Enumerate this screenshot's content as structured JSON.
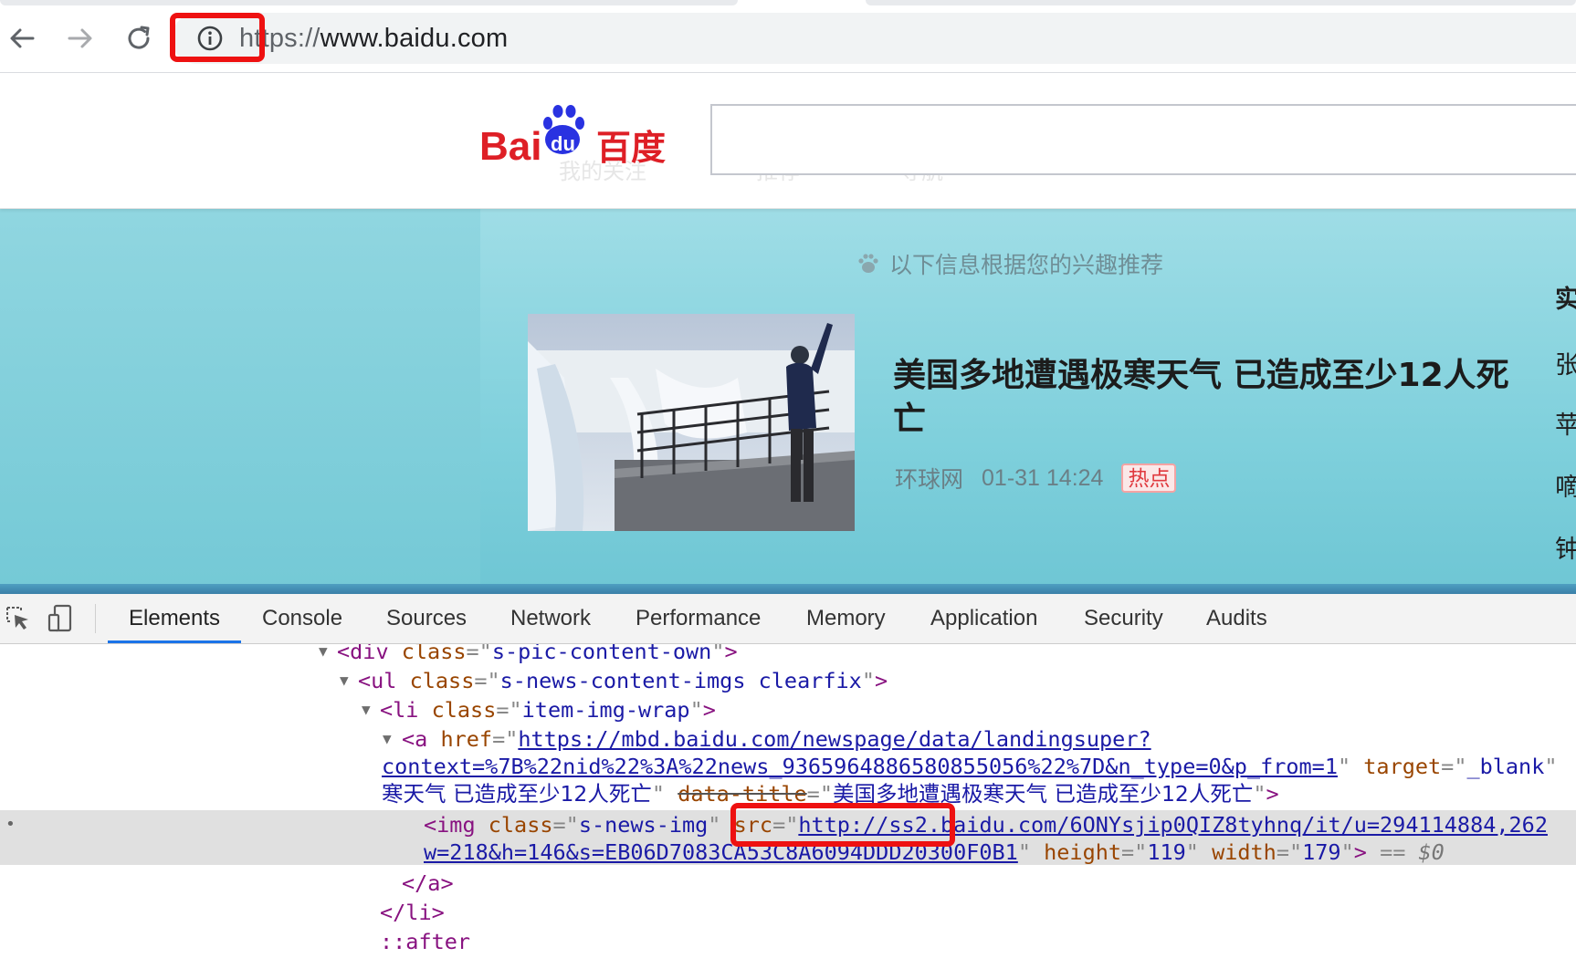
{
  "browser": {
    "url_scheme": "h",
    "url_scheme_rest": "ttps://",
    "url_host": "www.baidu.com"
  },
  "page": {
    "logo_text_bai": "Bai",
    "logo_text_du": "du",
    "logo_text_cn": "百度",
    "ghost_menu": [
      "我的关注",
      "推荐",
      "导航"
    ],
    "recommend_text": "以下信息根据您的兴趣推荐",
    "news": {
      "title": "美国多地遭遇极寒天气 已造成至少12人死亡",
      "source": "环球网",
      "time": "01-31 14:24",
      "badge": "热点"
    },
    "side_chars": [
      "实",
      "张",
      "苹",
      "嘀",
      "钟"
    ]
  },
  "devtools": {
    "tabs": [
      "Elements",
      "Console",
      "Sources",
      "Network",
      "Performance",
      "Memory",
      "Application",
      "Security",
      "Audits"
    ],
    "active_tab": "Elements",
    "lines": {
      "l1_tag": "div",
      "l1_attr": "class",
      "l1_val": "s-pic-content-own",
      "l2_tag": "ul",
      "l2_attr": "class",
      "l2_val": "s-news-content-imgs clearfix",
      "l3_tag": "li",
      "l3_attr": "class",
      "l3_val": "item-img-wrap",
      "l4_tag": "a",
      "l4_attr": "href",
      "l4_val": "https://mbd.baidu.com/newspage/data/landingsuper?",
      "l5_val": "context=%7B%22nid%22%3A%22news_9365964886580855056%22%7D&n_type=0&p_from=1",
      "l5_attr": "target",
      "l5_attr_val": "_blank",
      "l6_text": "寒天气 已造成至少12人死亡",
      "l6_attr": "data-title",
      "l6_val": "美国多地遭遇极寒天气 已造成至少12人死亡",
      "l7_tag": "img",
      "l7_attr1": "class",
      "l7_val1": "s-news-img",
      "l7_attr2": "src",
      "l7_src_a": "http://ss2.",
      "l7_src_b": "baidu.com/6ONYsjip0QIZ8tyhnq/it/u=294114884,262",
      "l8_src": "w=218&h=146&s=EB06D7083CA53C8A6094DDD20300F0B1",
      "l8_attr1": "height",
      "l8_val1": "119",
      "l8_attr2": "width",
      "l8_val2": "179",
      "l8_eq": "==",
      "l8_dollar": "$0",
      "l9_close": "</a>",
      "l10_close": "</li>",
      "l11_pseudo": "::after"
    }
  },
  "colors": {
    "highlight": "#ee1111",
    "logo_red": "#de1f26",
    "logo_blue": "#2932e1",
    "devtools_active": "#1a73e8"
  }
}
